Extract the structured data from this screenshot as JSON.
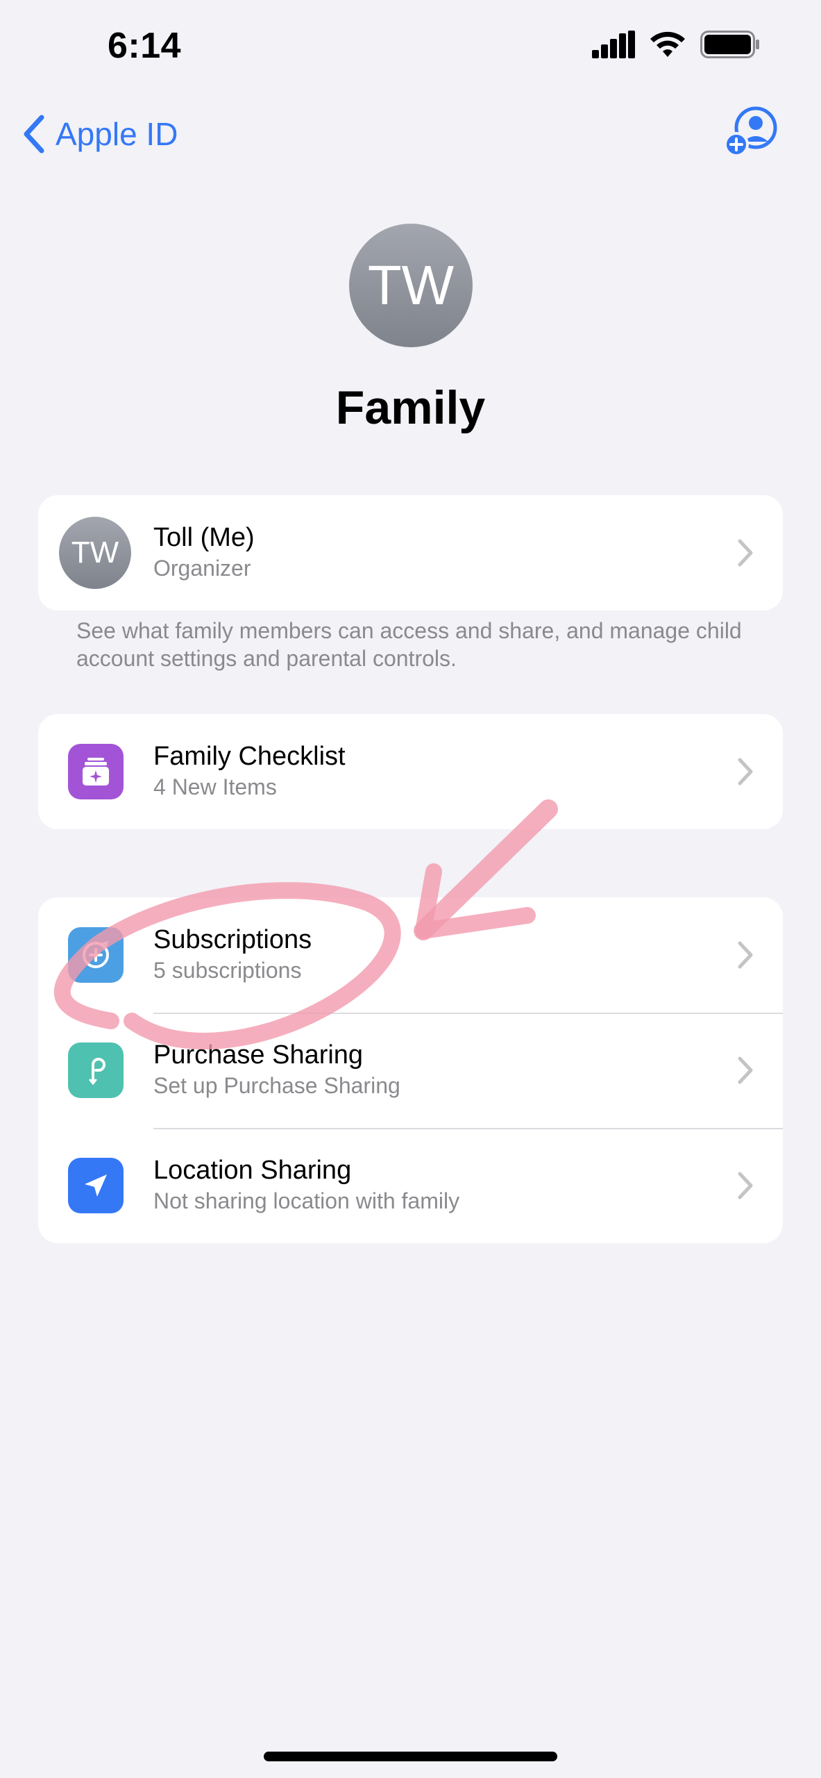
{
  "status_bar": {
    "time": "6:14"
  },
  "nav": {
    "back_label": "Apple ID"
  },
  "hero": {
    "initials": "TW",
    "title": "Family"
  },
  "member": {
    "initials": "TW",
    "name": "Toll (Me)",
    "role": "Organizer"
  },
  "footnote": "See what family members can access and share, and manage child account settings and parental controls.",
  "checklist": {
    "title": "Family Checklist",
    "subtitle": "4 New Items"
  },
  "services": [
    {
      "title": "Subscriptions",
      "subtitle": "5 subscriptions"
    },
    {
      "title": "Purchase Sharing",
      "subtitle": "Set up Purchase Sharing"
    },
    {
      "title": "Location Sharing",
      "subtitle": "Not sharing location with family"
    }
  ],
  "colors": {
    "accent": "#3478f6",
    "checklist_icon": "#a354d6",
    "subscriptions_icon": "#4c9fe3",
    "purchase_icon": "#4fc1b0",
    "location_icon": "#3478f6",
    "annotation": "#f29aad"
  }
}
